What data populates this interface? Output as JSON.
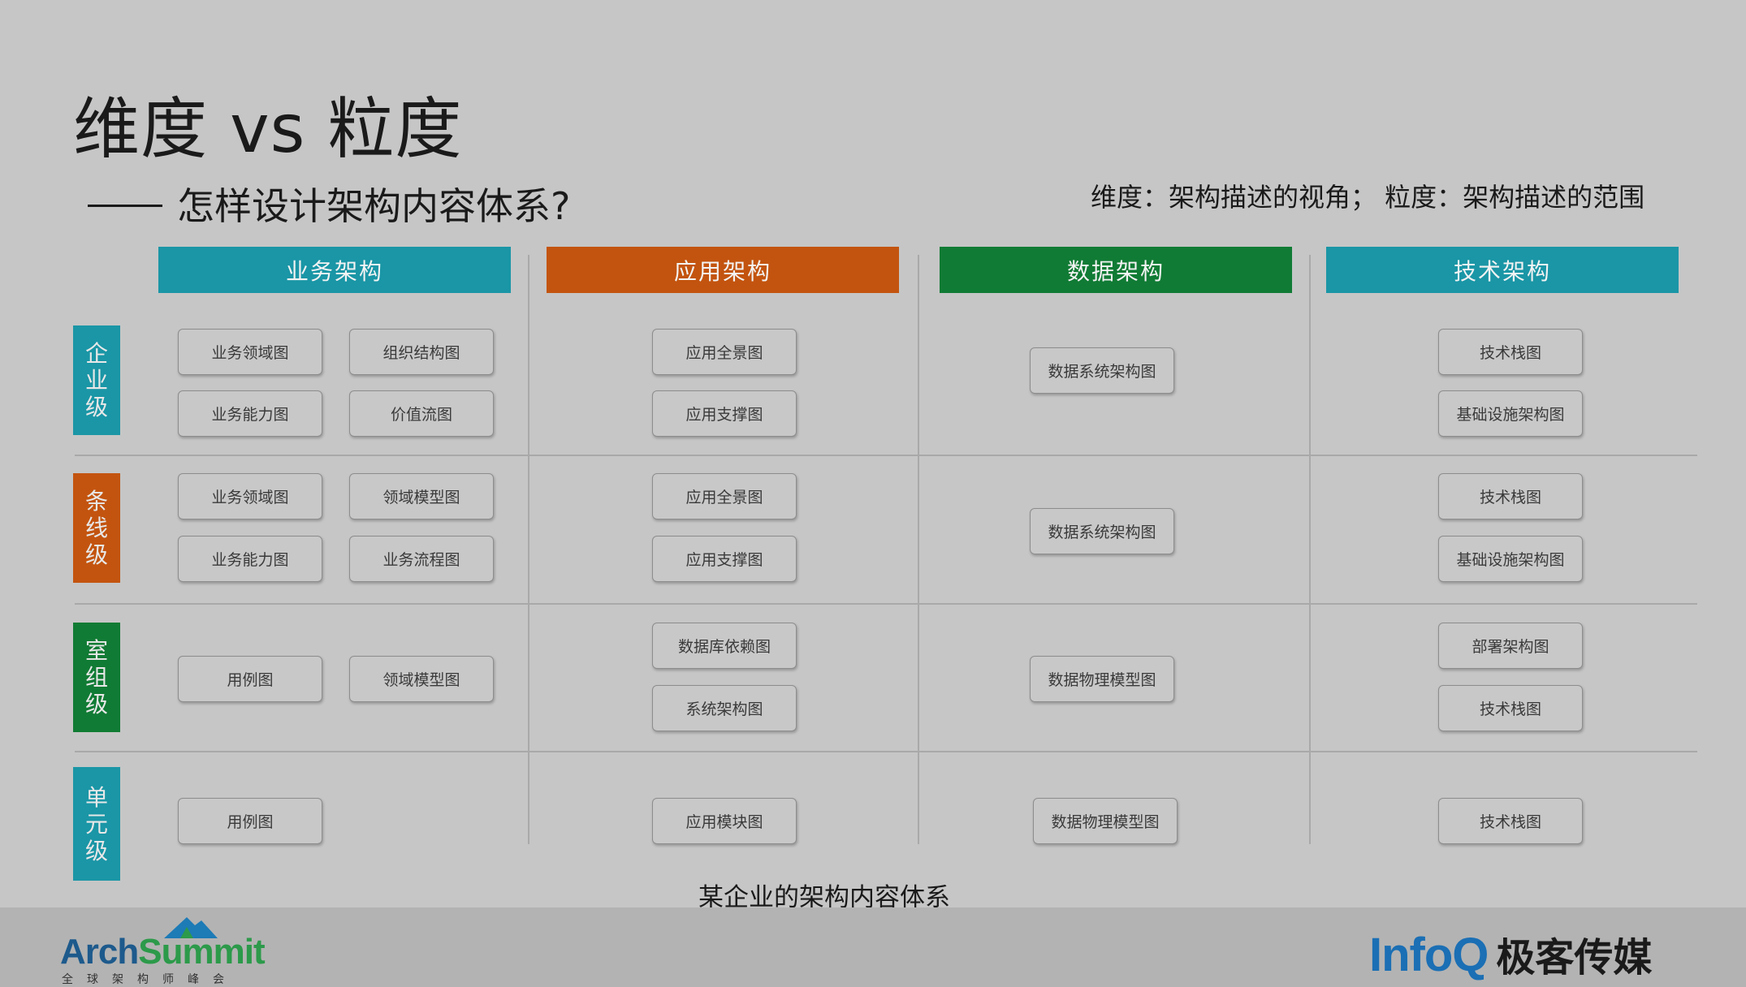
{
  "title": "维度 vs 粒度",
  "subtitle": "怎样设计架构内容体系?",
  "note": "维度：架构描述的视角； 粒度：架构描述的范围",
  "columns": [
    {
      "label": "业务架构",
      "color": "#1a96a6"
    },
    {
      "label": "应用架构",
      "color": "#c3540f"
    },
    {
      "label": "数据架构",
      "color": "#107b34"
    },
    {
      "label": "技术架构",
      "color": "#1a96a6"
    }
  ],
  "rows": [
    {
      "label": [
        "企",
        "业",
        "级"
      ],
      "color": "#1a96a6"
    },
    {
      "label": [
        "条",
        "线",
        "级"
      ],
      "color": "#c3540f"
    },
    {
      "label": [
        "室",
        "组",
        "级"
      ],
      "color": "#107b34"
    },
    {
      "label": [
        "单",
        "元",
        "级"
      ],
      "color": "#1a96a6"
    }
  ],
  "cells": {
    "r0": {
      "business": [
        "业务领域图",
        "组织结构图",
        "业务能力图",
        "价值流图"
      ],
      "application": [
        "应用全景图",
        "应用支撑图"
      ],
      "data": [
        "数据系统架构图"
      ],
      "technology": [
        "技术栈图",
        "基础设施架构图"
      ]
    },
    "r1": {
      "business": [
        "业务领域图",
        "领域模型图",
        "业务能力图",
        "业务流程图"
      ],
      "application": [
        "应用全景图",
        "应用支撑图"
      ],
      "data": [
        "数据系统架构图"
      ],
      "technology": [
        "技术栈图",
        "基础设施架构图"
      ]
    },
    "r2": {
      "business": [
        "用例图",
        "领域模型图"
      ],
      "application": [
        "数据库依赖图",
        "系统架构图"
      ],
      "data": [
        "数据物理模型图"
      ],
      "technology": [
        "部署架构图",
        "技术栈图"
      ]
    },
    "r3": {
      "business": [
        "用例图"
      ],
      "application": [
        "应用模块图"
      ],
      "data": [
        "数据物理模型图"
      ],
      "technology": [
        "技术栈图"
      ]
    }
  },
  "caption": "某企业的架构内容体系",
  "footer": {
    "archsummit_a": "Arch",
    "archsummit_b": "Summit",
    "archsummit_sub": "全球架构师峰会",
    "infoq": "InfoQ",
    "infoq_cn": "极客传媒"
  }
}
